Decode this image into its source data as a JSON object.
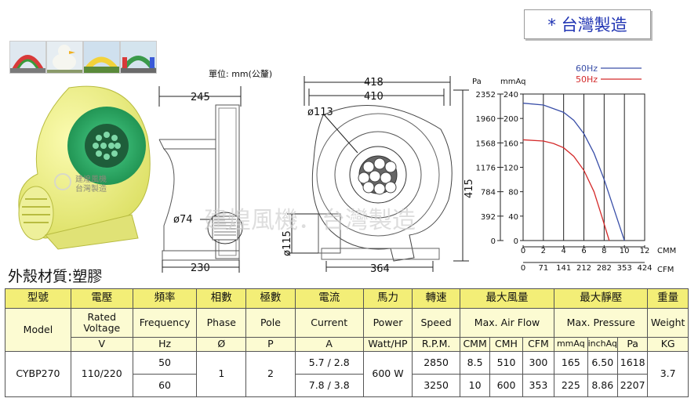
{
  "origin_label": "* 台灣製造",
  "unit_label": "單位: mm(公釐)",
  "material_label": "外殼材質:塑膠",
  "watermark": "建煌風機．台灣製造",
  "watermark_small": [
    "建煌風機",
    "台灣製造"
  ],
  "side_view": {
    "width_top": "245",
    "width_bottom": "230",
    "outlet_diameter": "ø74"
  },
  "front_view": {
    "width_outer": "418",
    "width_inner": "410",
    "height": "415",
    "width_bottom": "364",
    "inlet_diameter": "ø113",
    "outlet_diameter": "ø115"
  },
  "chart_data": {
    "type": "line",
    "x_label": "CMM",
    "x2_label": "CFM",
    "y_label_pa": "Pa",
    "y_label_mmaq": "mmAq",
    "x_ticks": [
      "0",
      "2",
      "4",
      "6",
      "8",
      "10",
      "12"
    ],
    "x2_ticks": [
      "0",
      "71",
      "141",
      "212",
      "282",
      "353",
      "424"
    ],
    "y_pa_ticks": [
      "0",
      "392",
      "784",
      "1176",
      "1568",
      "1960",
      "2352"
    ],
    "y_mmaq_ticks": [
      "0",
      "40",
      "80",
      "120",
      "160",
      "200",
      "240"
    ],
    "xlim": [
      0,
      12
    ],
    "ylim": [
      0,
      240
    ],
    "legend_position": "top-right",
    "series": [
      {
        "name": "60Hz",
        "color": "#3a4fa8",
        "x": [
          0,
          2,
          4,
          5,
          6,
          7,
          8,
          9,
          10
        ],
        "y": [
          225,
          222,
          210,
          197,
          175,
          143,
          100,
          50,
          0
        ]
      },
      {
        "name": "50Hz",
        "color": "#d42a2a",
        "x": [
          0,
          2,
          3,
          4,
          5,
          6,
          7,
          7.8,
          8.5
        ],
        "y": [
          165,
          163,
          159,
          152,
          138,
          115,
          80,
          38,
          0
        ]
      }
    ]
  },
  "table": {
    "header_zh": [
      "型號",
      "電壓",
      "頻率",
      "相數",
      "極數",
      "電流",
      "馬力",
      "轉速",
      "最大風量",
      "最大靜壓",
      "重量"
    ],
    "header_en": [
      "Model",
      "Rated Voltage",
      "Frequency",
      "Phase",
      "Pole",
      "Current",
      "Power",
      "Speed",
      "Max. Air Flow",
      "Max. Pressure",
      "Weight"
    ],
    "units": [
      "V",
      "Hz",
      "Ø",
      "P",
      "A",
      "Watt/HP",
      "R.P.M.",
      "CMM",
      "CMH",
      "CFM",
      "mmAq",
      "inchAq",
      "Pa",
      "KG"
    ],
    "model": "CYBP270",
    "voltage": "110/220",
    "phase": "1",
    "pole": "2",
    "power": "600 W",
    "weight": "3.7",
    "rows": [
      {
        "freq": "50",
        "current": "5.7 / 2.8",
        "speed": "2850",
        "cmm": "8.5",
        "cmh": "510",
        "cfm": "300",
        "mmaq": "165",
        "inchaq": "6.50",
        "pa": "1618"
      },
      {
        "freq": "60",
        "current": "7.8 / 3.8",
        "speed": "3250",
        "cmm": "10",
        "cmh": "600",
        "cfm": "353",
        "mmaq": "225",
        "inchaq": "8.86",
        "pa": "2207"
      }
    ]
  }
}
